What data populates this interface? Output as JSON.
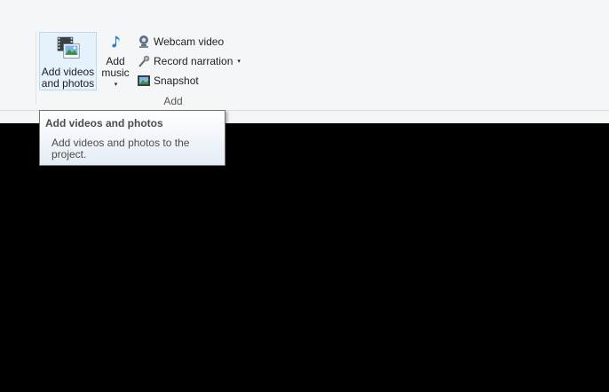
{
  "ribbon": {
    "add_videos": {
      "line1": "Add videos",
      "line2": "and photos",
      "icon": "film-photo-icon"
    },
    "add_music": {
      "line1": "Add",
      "line2": "music",
      "arrow": "▾",
      "icon": "music-note-icon"
    },
    "webcam": {
      "label": "Webcam video",
      "icon": "webcam-icon"
    },
    "narration": {
      "label": "Record narration",
      "arrow": "▾",
      "icon": "microphone-icon"
    },
    "snapshot": {
      "label": "Snapshot",
      "icon": "snapshot-icon"
    },
    "group_label": "Add"
  },
  "tooltip": {
    "title": "Add videos and photos",
    "body": "Add videos and photos to the project."
  },
  "colors": {
    "ribbon_bg": "#f5f6f7",
    "hover_bg": "#e5f1fb",
    "hover_border": "#bcd9f0",
    "preview_bg": "#000000"
  }
}
